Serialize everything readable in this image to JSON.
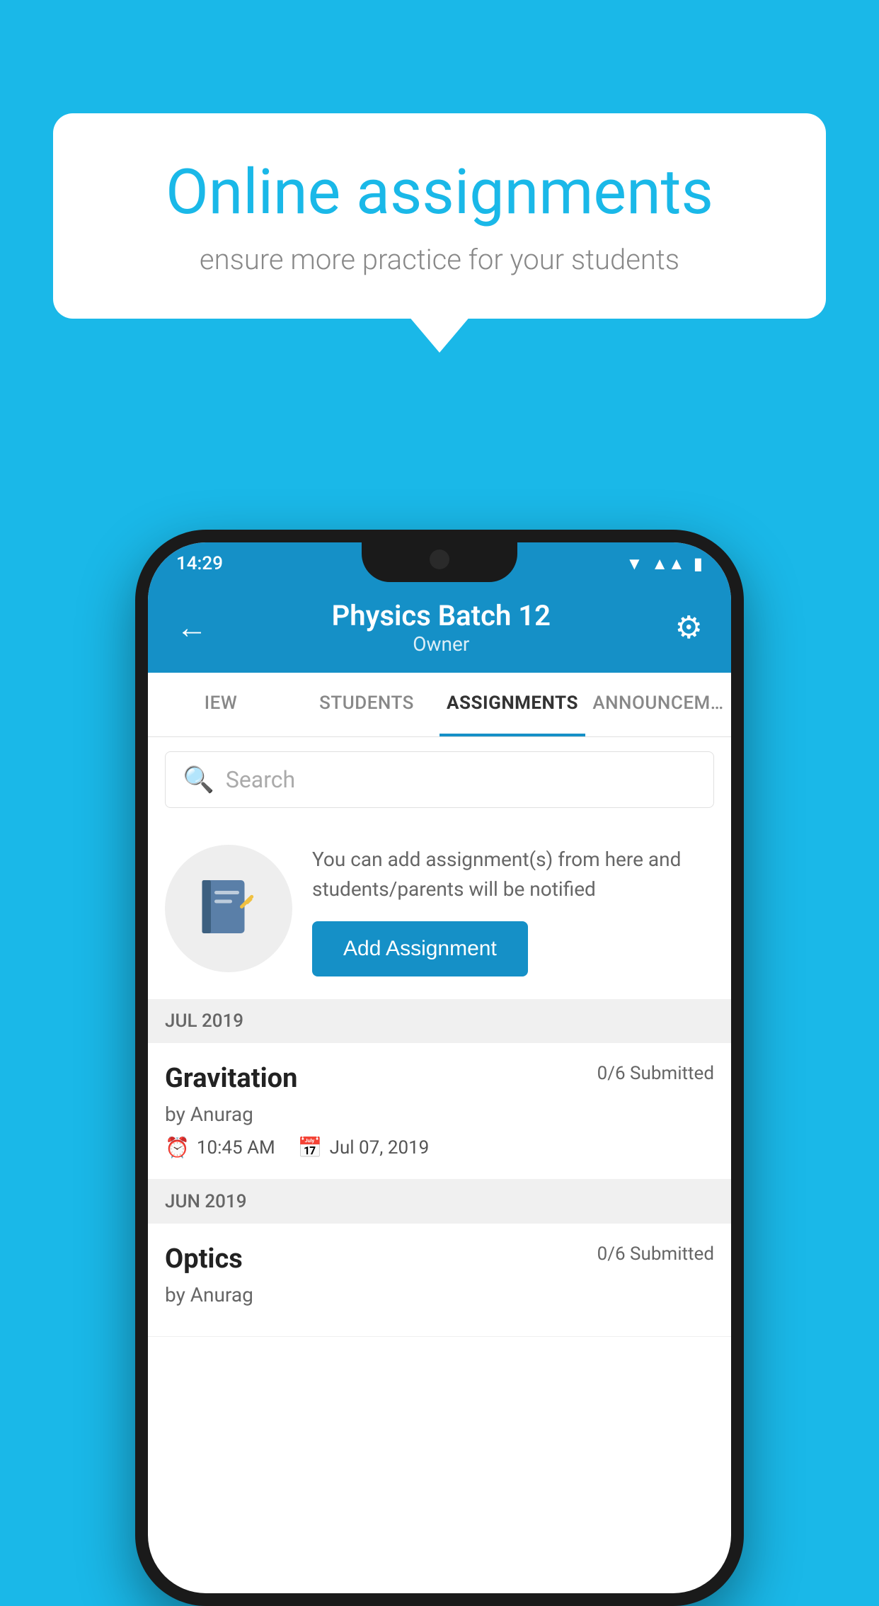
{
  "background_color": "#1ab8e8",
  "speech_bubble": {
    "title": "Online assignments",
    "subtitle": "ensure more practice for your students"
  },
  "status_bar": {
    "time": "14:29",
    "wifi_icon": "wifi",
    "signal_icon": "signal",
    "battery_icon": "battery"
  },
  "header": {
    "title": "Physics Batch 12",
    "subtitle": "Owner",
    "back_label": "←",
    "settings_label": "⚙"
  },
  "tabs": [
    {
      "label": "IEW",
      "active": false
    },
    {
      "label": "STUDENTS",
      "active": false
    },
    {
      "label": "ASSIGNMENTS",
      "active": true
    },
    {
      "label": "ANNOUNCEM…",
      "active": false
    }
  ],
  "search": {
    "placeholder": "Search"
  },
  "add_assignment": {
    "description": "You can add assignment(s) from here and students/parents will be notified",
    "button_label": "Add Assignment"
  },
  "sections": [
    {
      "label": "JUL 2019",
      "assignments": [
        {
          "title": "Gravitation",
          "submitted": "0/6 Submitted",
          "author": "by Anurag",
          "time": "10:45 AM",
          "date": "Jul 07, 2019"
        }
      ]
    },
    {
      "label": "JUN 2019",
      "assignments": [
        {
          "title": "Optics",
          "submitted": "0/6 Submitted",
          "author": "by Anurag",
          "time": "",
          "date": ""
        }
      ]
    }
  ]
}
